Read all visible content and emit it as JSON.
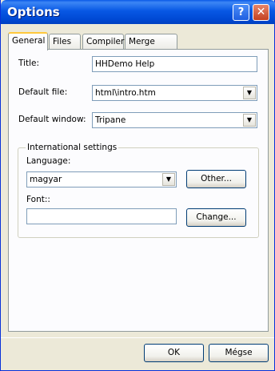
{
  "window": {
    "title": "Options"
  },
  "tabs": [
    {
      "label": "General"
    },
    {
      "label": "Files"
    },
    {
      "label": "Compiler"
    },
    {
      "label": "Merge Files"
    }
  ],
  "general": {
    "title_label": "Title:",
    "title_value": "HHDemo Help",
    "default_file_label": "Default file:",
    "default_file_value": "html\\intro.htm",
    "default_window_label": "Default window:",
    "default_window_value": "Tripane",
    "international": {
      "legend": "International settings",
      "language_label": "Language:",
      "language_value": "magyar",
      "other_button": "Other...",
      "font_label": "Font::",
      "font_value": "",
      "change_button": "Change..."
    }
  },
  "footer": {
    "ok_button": "OK",
    "cancel_button": "Mégse"
  }
}
